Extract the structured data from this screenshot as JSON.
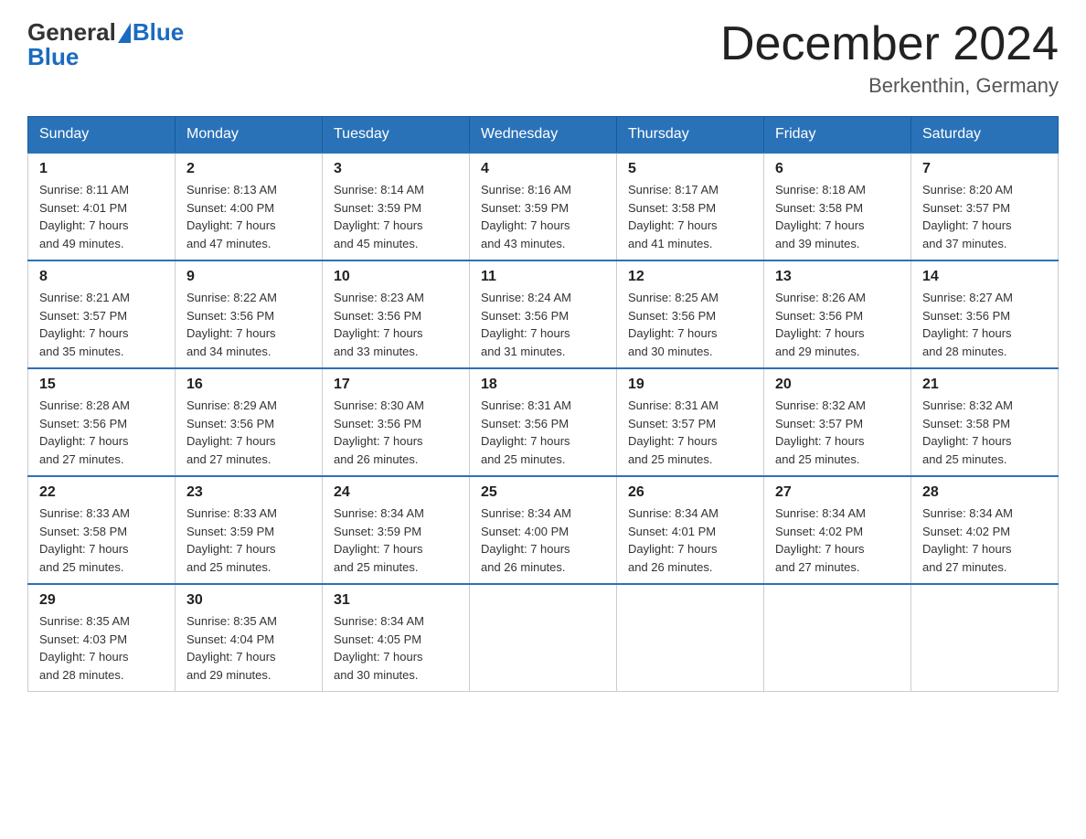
{
  "header": {
    "logo_general": "General",
    "logo_blue": "Blue",
    "title": "December 2024",
    "subtitle": "Berkenthin, Germany"
  },
  "weekdays": [
    "Sunday",
    "Monday",
    "Tuesday",
    "Wednesday",
    "Thursday",
    "Friday",
    "Saturday"
  ],
  "weeks": [
    [
      {
        "day": "1",
        "sunrise": "8:11 AM",
        "sunset": "4:01 PM",
        "daylight": "7 hours and 49 minutes."
      },
      {
        "day": "2",
        "sunrise": "8:13 AM",
        "sunset": "4:00 PM",
        "daylight": "7 hours and 47 minutes."
      },
      {
        "day": "3",
        "sunrise": "8:14 AM",
        "sunset": "3:59 PM",
        "daylight": "7 hours and 45 minutes."
      },
      {
        "day": "4",
        "sunrise": "8:16 AM",
        "sunset": "3:59 PM",
        "daylight": "7 hours and 43 minutes."
      },
      {
        "day": "5",
        "sunrise": "8:17 AM",
        "sunset": "3:58 PM",
        "daylight": "7 hours and 41 minutes."
      },
      {
        "day": "6",
        "sunrise": "8:18 AM",
        "sunset": "3:58 PM",
        "daylight": "7 hours and 39 minutes."
      },
      {
        "day": "7",
        "sunrise": "8:20 AM",
        "sunset": "3:57 PM",
        "daylight": "7 hours and 37 minutes."
      }
    ],
    [
      {
        "day": "8",
        "sunrise": "8:21 AM",
        "sunset": "3:57 PM",
        "daylight": "7 hours and 35 minutes."
      },
      {
        "day": "9",
        "sunrise": "8:22 AM",
        "sunset": "3:56 PM",
        "daylight": "7 hours and 34 minutes."
      },
      {
        "day": "10",
        "sunrise": "8:23 AM",
        "sunset": "3:56 PM",
        "daylight": "7 hours and 33 minutes."
      },
      {
        "day": "11",
        "sunrise": "8:24 AM",
        "sunset": "3:56 PM",
        "daylight": "7 hours and 31 minutes."
      },
      {
        "day": "12",
        "sunrise": "8:25 AM",
        "sunset": "3:56 PM",
        "daylight": "7 hours and 30 minutes."
      },
      {
        "day": "13",
        "sunrise": "8:26 AM",
        "sunset": "3:56 PM",
        "daylight": "7 hours and 29 minutes."
      },
      {
        "day": "14",
        "sunrise": "8:27 AM",
        "sunset": "3:56 PM",
        "daylight": "7 hours and 28 minutes."
      }
    ],
    [
      {
        "day": "15",
        "sunrise": "8:28 AM",
        "sunset": "3:56 PM",
        "daylight": "7 hours and 27 minutes."
      },
      {
        "day": "16",
        "sunrise": "8:29 AM",
        "sunset": "3:56 PM",
        "daylight": "7 hours and 27 minutes."
      },
      {
        "day": "17",
        "sunrise": "8:30 AM",
        "sunset": "3:56 PM",
        "daylight": "7 hours and 26 minutes."
      },
      {
        "day": "18",
        "sunrise": "8:31 AM",
        "sunset": "3:56 PM",
        "daylight": "7 hours and 25 minutes."
      },
      {
        "day": "19",
        "sunrise": "8:31 AM",
        "sunset": "3:57 PM",
        "daylight": "7 hours and 25 minutes."
      },
      {
        "day": "20",
        "sunrise": "8:32 AM",
        "sunset": "3:57 PM",
        "daylight": "7 hours and 25 minutes."
      },
      {
        "day": "21",
        "sunrise": "8:32 AM",
        "sunset": "3:58 PM",
        "daylight": "7 hours and 25 minutes."
      }
    ],
    [
      {
        "day": "22",
        "sunrise": "8:33 AM",
        "sunset": "3:58 PM",
        "daylight": "7 hours and 25 minutes."
      },
      {
        "day": "23",
        "sunrise": "8:33 AM",
        "sunset": "3:59 PM",
        "daylight": "7 hours and 25 minutes."
      },
      {
        "day": "24",
        "sunrise": "8:34 AM",
        "sunset": "3:59 PM",
        "daylight": "7 hours and 25 minutes."
      },
      {
        "day": "25",
        "sunrise": "8:34 AM",
        "sunset": "4:00 PM",
        "daylight": "7 hours and 26 minutes."
      },
      {
        "day": "26",
        "sunrise": "8:34 AM",
        "sunset": "4:01 PM",
        "daylight": "7 hours and 26 minutes."
      },
      {
        "day": "27",
        "sunrise": "8:34 AM",
        "sunset": "4:02 PM",
        "daylight": "7 hours and 27 minutes."
      },
      {
        "day": "28",
        "sunrise": "8:34 AM",
        "sunset": "4:02 PM",
        "daylight": "7 hours and 27 minutes."
      }
    ],
    [
      {
        "day": "29",
        "sunrise": "8:35 AM",
        "sunset": "4:03 PM",
        "daylight": "7 hours and 28 minutes."
      },
      {
        "day": "30",
        "sunrise": "8:35 AM",
        "sunset": "4:04 PM",
        "daylight": "7 hours and 29 minutes."
      },
      {
        "day": "31",
        "sunrise": "8:34 AM",
        "sunset": "4:05 PM",
        "daylight": "7 hours and 30 minutes."
      },
      null,
      null,
      null,
      null
    ]
  ],
  "labels": {
    "sunrise": "Sunrise:",
    "sunset": "Sunset:",
    "daylight": "Daylight:"
  }
}
